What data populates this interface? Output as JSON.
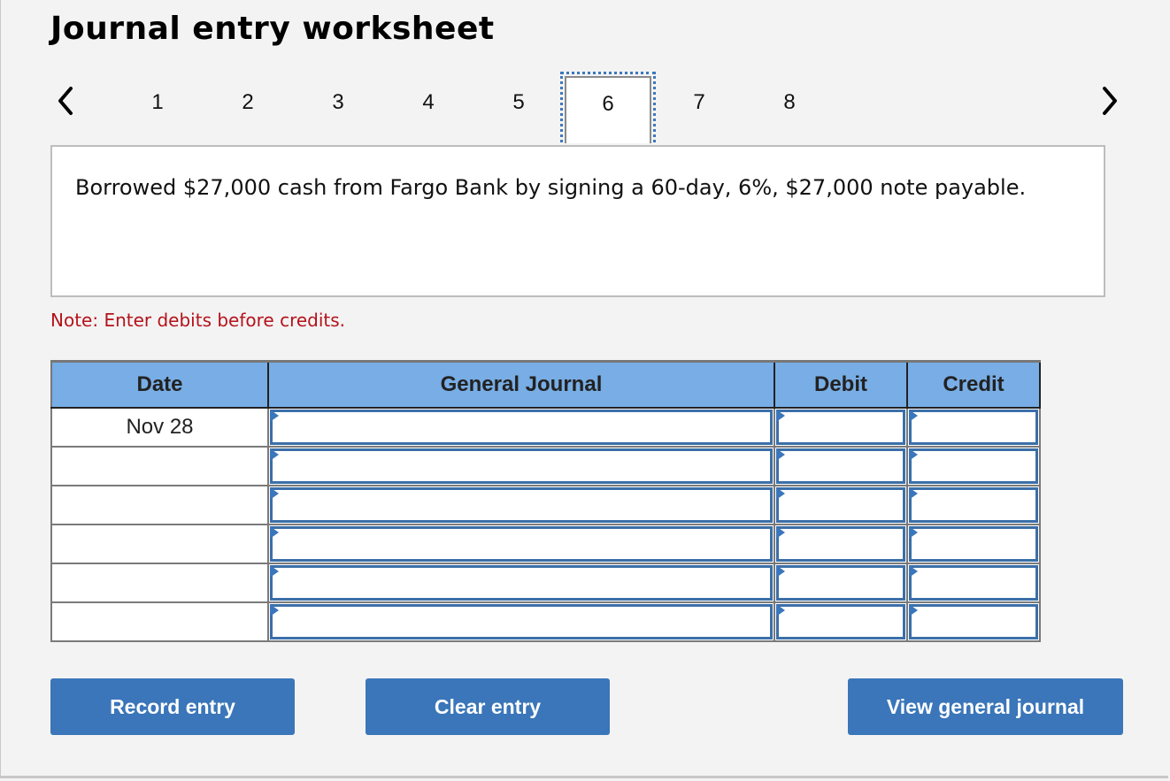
{
  "title": "Journal entry worksheet",
  "pager": {
    "prev_icon": "chevron-left-icon",
    "next_icon": "chevron-right-icon",
    "pages": [
      "1",
      "2",
      "3",
      "4",
      "5",
      "6",
      "7",
      "8"
    ],
    "active_page": "6"
  },
  "description": "Borrowed $27,000 cash from Fargo Bank by signing a 60-day, 6%, $27,000 note payable.",
  "note": "Note: Enter debits before credits.",
  "table": {
    "headers": [
      "Date",
      "General Journal",
      "Debit",
      "Credit"
    ],
    "rows": [
      {
        "date": "Nov 28",
        "account": "",
        "debit": "",
        "credit": ""
      },
      {
        "date": "",
        "account": "",
        "debit": "",
        "credit": ""
      },
      {
        "date": "",
        "account": "",
        "debit": "",
        "credit": ""
      },
      {
        "date": "",
        "account": "",
        "debit": "",
        "credit": ""
      },
      {
        "date": "",
        "account": "",
        "debit": "",
        "credit": ""
      },
      {
        "date": "",
        "account": "",
        "debit": "",
        "credit": ""
      }
    ]
  },
  "buttons": {
    "record": "Record entry",
    "clear": "Clear entry",
    "view": "View general journal"
  },
  "colors": {
    "accent": "#3a76b9",
    "header_bg": "#78ade5",
    "note": "#b5121b"
  }
}
